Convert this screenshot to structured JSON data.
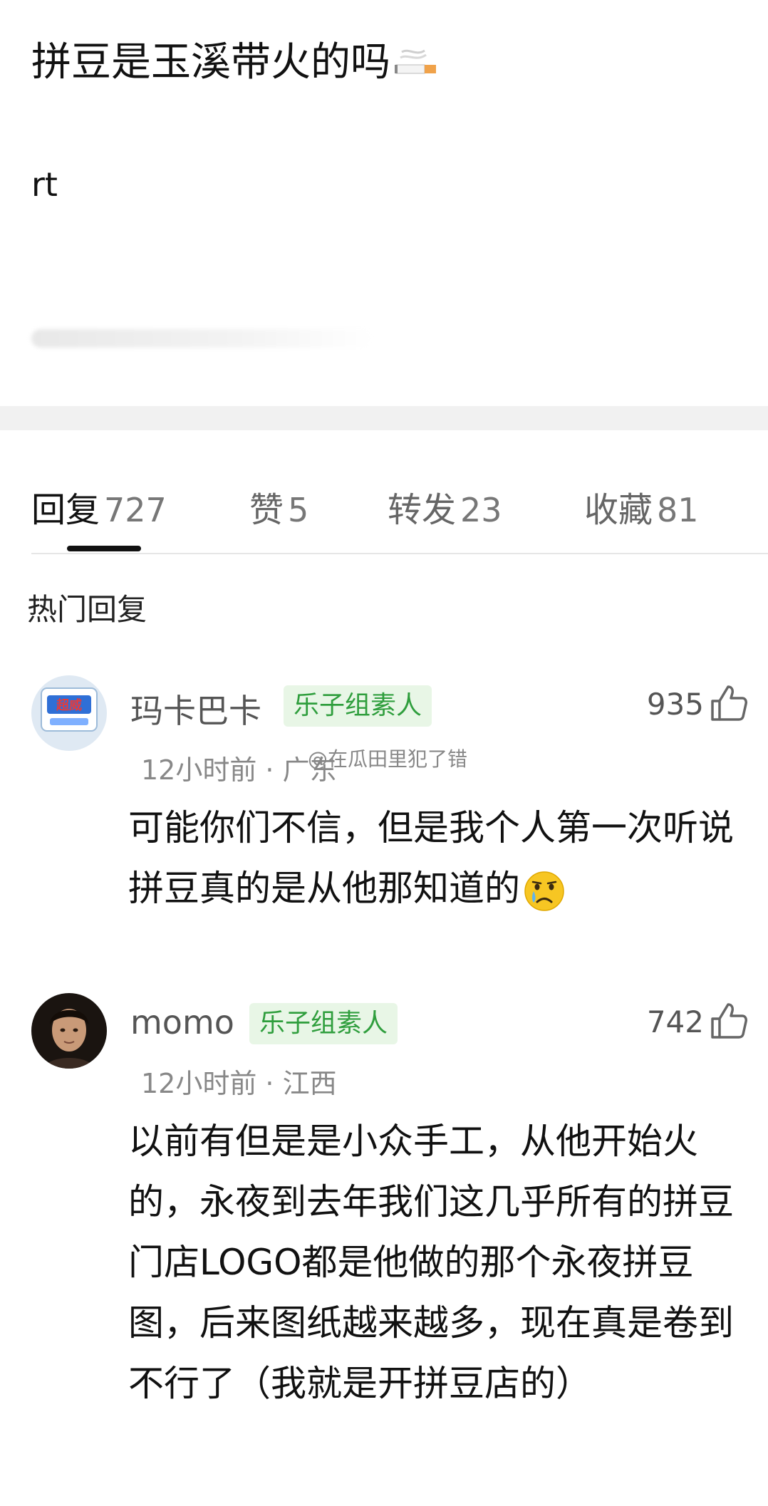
{
  "post": {
    "title": "拼豆是玉溪带火的吗",
    "title_emoji": "cigarette-icon",
    "body": "rt"
  },
  "tabs": [
    {
      "label": "回复",
      "count": "727",
      "active": true
    },
    {
      "label": "赞",
      "count": "5",
      "active": false
    },
    {
      "label": "转发",
      "count": "23",
      "active": false
    },
    {
      "label": "收藏",
      "count": "81",
      "active": false
    }
  ],
  "section_title": "热门回复",
  "comments": [
    {
      "name": "玛卡巴卡",
      "badge": "乐子组素人",
      "likes": "935",
      "meta": "12小时前 · 广东",
      "watermark": "@在瓜田里犯了错",
      "text": "可能你们不信，但是我个人第一次听说拼豆真的是从他那知道的",
      "emoji": "crying-face-icon",
      "avatar_label": "超威"
    },
    {
      "name": "momo",
      "badge": "乐子组素人",
      "likes": "742",
      "meta": "12小时前 · 江西",
      "text": "以前有但是是小众手工，从他开始火的，永夜到去年我们这几乎所有的拼豆门店LOGO都是他做的那个永夜拼豆图，后来图纸越来越多，现在真是卷到不行了（我就是开拼豆店的）"
    }
  ],
  "colors": {
    "badge_bg": "#e8f6e6",
    "badge_text": "#2f9e3d",
    "divider": "#f1f1f1"
  }
}
